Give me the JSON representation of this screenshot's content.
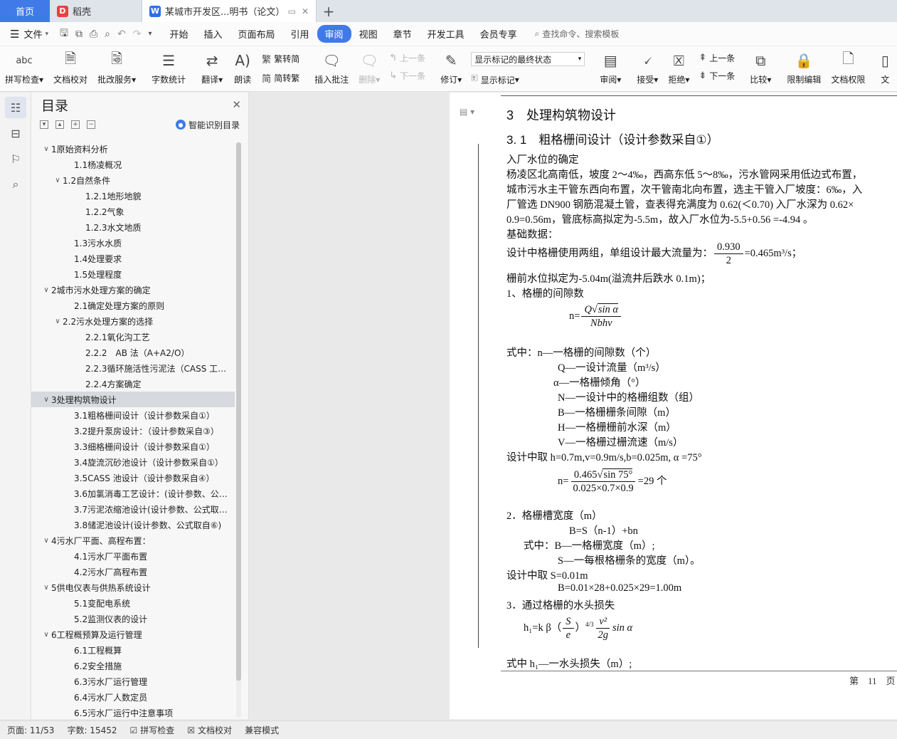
{
  "tabs": {
    "home": "首页",
    "daoke": "稻壳",
    "doc": "某城市开发区...明书（论文）",
    "add": "+"
  },
  "menu": {
    "file": "文件",
    "items": [
      "开始",
      "插入",
      "页面布局",
      "引用",
      "审阅",
      "视图",
      "章节",
      "开发工具",
      "会员专享"
    ],
    "active": "审阅",
    "search": "查找命令、搜索模板"
  },
  "ribbon": {
    "spell": "拼写检查",
    "doccheck": "文档校对",
    "annotate_service": "批改服务",
    "wordcount": "字数统计",
    "translate": "翻译",
    "read": "朗读",
    "to_trad": "繁转简",
    "to_simp": "简转繁",
    "insert_comment": "插入批注",
    "delete": "删除",
    "prev_comment": "上一条",
    "next_comment": "下一条",
    "revise": "修订",
    "markup_select": "显示标记的最终状态",
    "show_markup": "显示标记",
    "review": "审阅",
    "accept": "接受",
    "reject": "拒绝",
    "prev": "上一条",
    "next": "下一条",
    "compare": "比较",
    "restrict": "限制编辑",
    "permission": "文档权限",
    "more": "文"
  },
  "toc": {
    "title": "目录",
    "smart": "智能识别目录",
    "items": [
      {
        "t": "1原始资料分析",
        "lv": 1,
        "exp": true
      },
      {
        "t": "1.1杨凌概况",
        "lv": 2
      },
      {
        "t": "1.2自然条件",
        "lv": 2,
        "exp": true
      },
      {
        "t": "1.2.1地形地貌",
        "lv": 3
      },
      {
        "t": "1.2.2气象",
        "lv": 3
      },
      {
        "t": "1.2.3水文地质",
        "lv": 3
      },
      {
        "t": "1.3污水水质",
        "lv": 2
      },
      {
        "t": "1.4处理要求",
        "lv": 2
      },
      {
        "t": "1.5处理程度",
        "lv": 2
      },
      {
        "t": "2城市污水处理方案的确定",
        "lv": 1,
        "exp": true
      },
      {
        "t": "2.1确定处理方案的原则",
        "lv": 2
      },
      {
        "t": "2.2污水处理方案的选择",
        "lv": 2,
        "exp": true
      },
      {
        "t": "2.2.1氧化沟工艺",
        "lv": 3
      },
      {
        "t": "2.2.2　AB 法（A+A2/O）",
        "lv": 3
      },
      {
        "t": "2.2.3循环施活性污泥法（CASS 工艺）",
        "lv": 3
      },
      {
        "t": "2.2.4方案确定",
        "lv": 3
      },
      {
        "t": "3处理构筑物设计",
        "lv": 1,
        "exp": true,
        "sel": true
      },
      {
        "t": "3.1粗格栅间设计（设计参数采自①）",
        "lv": 2
      },
      {
        "t": "3.2提升泵房设计：（设计参数采自③）",
        "lv": 2
      },
      {
        "t": "3.3细格栅间设计（设计参数采自①）",
        "lv": 2
      },
      {
        "t": "3.4旋流沉砂池设计（设计参数采自①）",
        "lv": 2
      },
      {
        "t": "3.5CASS 池设计（设计参数采自④）",
        "lv": 2
      },
      {
        "t": "3.6加氯消毒工艺设计：(设计参数、公式...",
        "lv": 2
      },
      {
        "t": "3.7污泥浓缩池设计(设计参数、公式取自...",
        "lv": 2
      },
      {
        "t": "3.8储泥池设计(设计参数、公式取自⑥)",
        "lv": 2
      },
      {
        "t": "4污水厂平面、高程布置：",
        "lv": 1,
        "exp": true
      },
      {
        "t": "4.1污水厂平面布置",
        "lv": 2
      },
      {
        "t": "4.2污水厂高程布置",
        "lv": 2
      },
      {
        "t": "5供电仪表与供热系统设计",
        "lv": 1,
        "exp": true
      },
      {
        "t": "5.1变配电系统",
        "lv": 2
      },
      {
        "t": "5.2监测仪表的设计",
        "lv": 2
      },
      {
        "t": "6工程概预算及运行管理",
        "lv": 1,
        "exp": true
      },
      {
        "t": "6.1工程概算",
        "lv": 2
      },
      {
        "t": "6.2安全措施",
        "lv": 2
      },
      {
        "t": "6.3污水厂运行管理",
        "lv": 2
      },
      {
        "t": "6.4污水厂人数定员",
        "lv": 2
      },
      {
        "t": "6.5污水厂运行中注意事项",
        "lv": 2
      }
    ]
  },
  "doc": {
    "h3": "3　处理构筑物设计",
    "h4": "3. 1　粗格栅间设计（设计参数采自①）",
    "p1": "入厂水位的确定",
    "p2": "杨凌区北高南低，坡度 2～4‰，西高东低 5～8‰，污水管网采用低边式布置，",
    "p3": "城市污水主干管东西向布置，次干管南北向布置，选主干管入厂坡度：6‰，入",
    "p4": "厂管选 DN900 钢筋混凝土管，查表得充满度为 0.62(＜0.70) 入厂水深为 0.62×",
    "p5": "0.9=0.56m，管底标高拟定为-5.5m，故入厂水位为-5.5+0.56 =-4.94 。",
    "p6": "基础数据：",
    "p7a": "设计中格栅使用两组，单组设计最大流量为：",
    "p7num": "0.930",
    "p7den": "2",
    "p7b": "=0.465m³/s；",
    "p8": "栅前水位拟定为-5.04m(溢流井后跌水 0.1m)；",
    "p9": "1、格栅的间隙数",
    "f1pre": "n=",
    "f1num_q": "Q",
    "f1num_r": "sin α",
    "f1den": "Nbhv",
    "w1": "式中：n—一格栅的间隙数（个）",
    "w2": "Q—一设计流量（m³/s）",
    "w3": "α—一格栅倾角（°）",
    "w4": "N—一设计中的格栅组数（组）",
    "w5": "B—一格栅栅条间隙（m）",
    "w6": "H—一格栅栅前水深（m）",
    "w7": "V—一格栅过栅流速（m/s）",
    "p10": "设计中取 h=0.7m,v=0.9m/s,b=0.025m, α =75°",
    "f2pre": "n=",
    "f2num_a": "0.465",
    "f2num_r": "sin 75°",
    "f2den": "0.025×0.7×0.9",
    "f2post": "=29 个",
    "p11": "2．格栅槽宽度（m）",
    "p12": "B=S（n-1）+bn",
    "p13": "式中：B—一格栅宽度（m）;",
    "p14": "S—一每根格栅条的宽度（m）。",
    "p15": "设计中取 S=0.01m",
    "p16": "B=0.01×28+0.025×29=1.00m",
    "p17": "3．通过格栅的水头损失",
    "f3pre": "h₁=k β（",
    "f3s": "S",
    "f3e": "e",
    "f3pow": "4/3",
    "f3vnum": "v²",
    "f3vden": "2g",
    "f3post": "sin α",
    "p18": "式中 h₁—一水头损失（m）;",
    "pagenum": "第　11　页"
  },
  "status": {
    "page": "页面: 11/53",
    "words": "字数: 15452",
    "spell": "拼写检查",
    "doccheck": "文档校对",
    "compat": "兼容模式"
  }
}
